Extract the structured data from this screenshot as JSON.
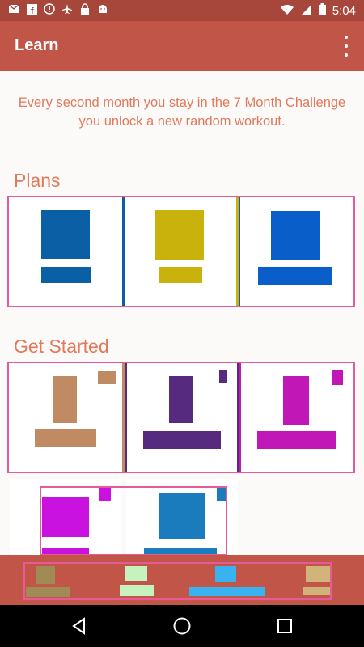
{
  "status_bar": {
    "time": "5:04",
    "icons": [
      "mail-icon",
      "facebook-icon",
      "alert-icon",
      "airplane-icon",
      "lock-icon",
      "android-icon",
      "wifi-icon",
      "signal-icon",
      "battery-icon"
    ]
  },
  "app_bar": {
    "title": "Learn",
    "menu_icon": "overflow-menu-icon"
  },
  "intro_text": "Every second month you stay in the 7 Month Challenge you unlock a new random workout.",
  "sections": {
    "plans": {
      "title": "Plans",
      "colors": [
        "#0b5fa5",
        "#c9b20b",
        "#0a5ec9"
      ]
    },
    "get_started": {
      "title": "Get Started",
      "colors": [
        "#c08a63",
        "#552a7f",
        "#c117b6"
      ]
    },
    "more": {
      "colors": [
        "#c912e0",
        "#1a7bbd"
      ]
    }
  },
  "bottom_bar": {
    "colors": [
      "#a08a55",
      "#c6f2bd",
      "#38b3f0",
      "#d0b47a"
    ]
  },
  "nav": [
    "back-icon",
    "home-icon",
    "recents-icon"
  ]
}
